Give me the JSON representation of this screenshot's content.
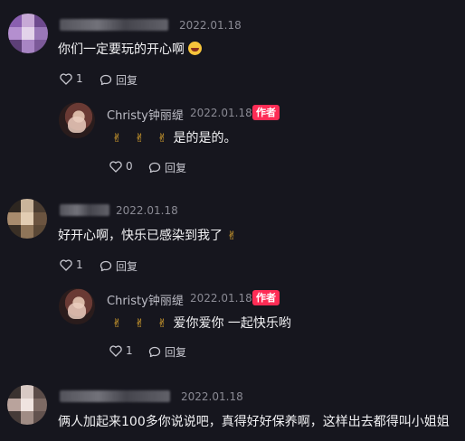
{
  "comments": [
    {
      "date": "2022.01.18",
      "text": "你们一定要玩的开心啊",
      "like_count": "1",
      "reply_label": "回复",
      "reply": {
        "name": "Christy钟丽缇",
        "date": "2022.01.18",
        "badge": "作者",
        "text": "是的是的。",
        "like_count": "0",
        "reply_label": "回复"
      }
    },
    {
      "date": "2022.01.18",
      "text": "好开心啊，快乐已感染到我了",
      "like_count": "1",
      "reply_label": "回复",
      "reply": {
        "name": "Christy钟丽缇",
        "date": "2022.01.18",
        "badge": "作者",
        "text": "爱你爱你 一起快乐哟",
        "like_count": "1",
        "reply_label": "回复"
      }
    },
    {
      "date": "2022.01.18",
      "text": "俩人加起来100多你说说吧，真得好好保养啊，这样出去都得叫小姐姐"
    }
  ],
  "icons": {
    "like": "heart-outline-icon",
    "reply": "speech-bubble-icon",
    "hand_emoji": "crossed-fingers-heart-icon",
    "laugh_emoji": "laughing-face-icon"
  },
  "colors": {
    "background": "#16161e",
    "badge": "#fe2c55",
    "date": "#8a8a94"
  }
}
